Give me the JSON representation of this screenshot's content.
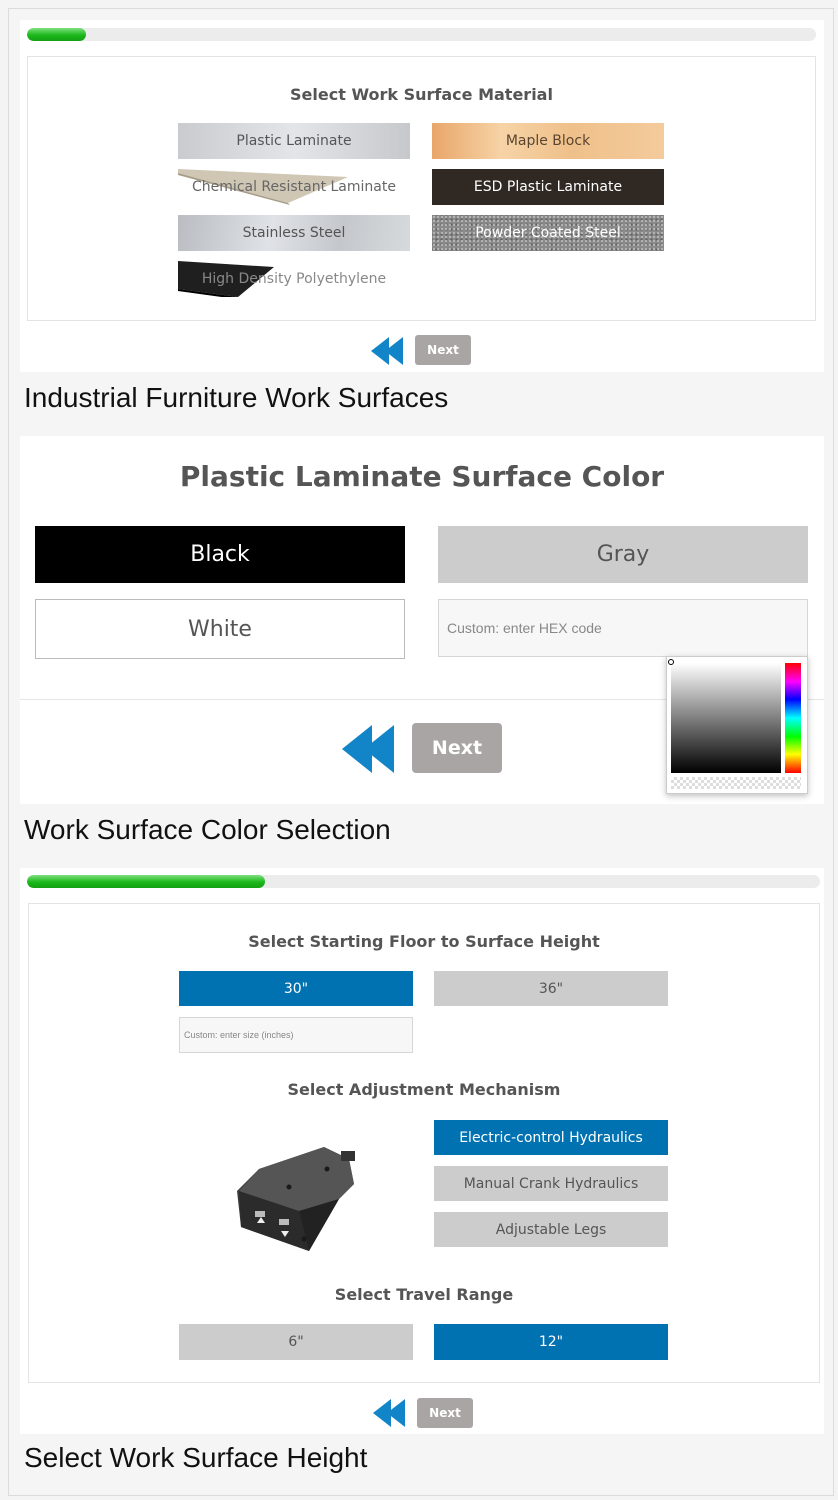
{
  "panel1": {
    "progress_fraction": 0.075,
    "heading": "Select Work Surface Material",
    "materials": [
      {
        "label": "Plastic Laminate"
      },
      {
        "label": "Maple Block"
      },
      {
        "label": "Chemical Resistant Laminate"
      },
      {
        "label": "ESD Plastic Laminate"
      },
      {
        "label": "Stainless Steel"
      },
      {
        "label": "Powder Coated Steel"
      },
      {
        "label": "High Density Polyethylene"
      }
    ],
    "next_label": "Next",
    "back_icon": "double-arrow-left-icon",
    "caption": "Industrial Furniture Work Surfaces"
  },
  "panel2": {
    "heading": "Plastic Laminate Surface Color",
    "colors": {
      "black": "Black",
      "gray": "Gray",
      "white": "White"
    },
    "custom_placeholder": "Custom: enter HEX code",
    "next_label": "Next",
    "back_icon": "double-arrow-left-icon",
    "caption": "Work Surface Color Selection"
  },
  "panel3": {
    "progress_fraction": 0.3,
    "height_heading": "Select Starting Floor to Surface Height",
    "heights": [
      "30\"",
      "36\""
    ],
    "height_selected": "30\"",
    "custom_size_placeholder": "Custom: enter size (inches)",
    "mechanism_heading": "Select Adjustment Mechanism",
    "mechanisms": [
      "Electric-control Hydraulics",
      "Manual Crank Hydraulics",
      "Adjustable Legs"
    ],
    "mechanism_selected": "Electric-control Hydraulics",
    "travel_heading": "Select Travel Range",
    "travel_ranges": [
      "6\"",
      "12\""
    ],
    "travel_selected": "12\"",
    "next_label": "Next",
    "back_icon": "double-arrow-left-icon",
    "caption": "Select Work Surface Height"
  },
  "colors": {
    "accent_blue": "#0072b1",
    "arrow_blue": "#1285c9",
    "progress_green": "#1bb81b",
    "next_gray": "#aaa5a5",
    "option_gray": "#cccccc"
  }
}
